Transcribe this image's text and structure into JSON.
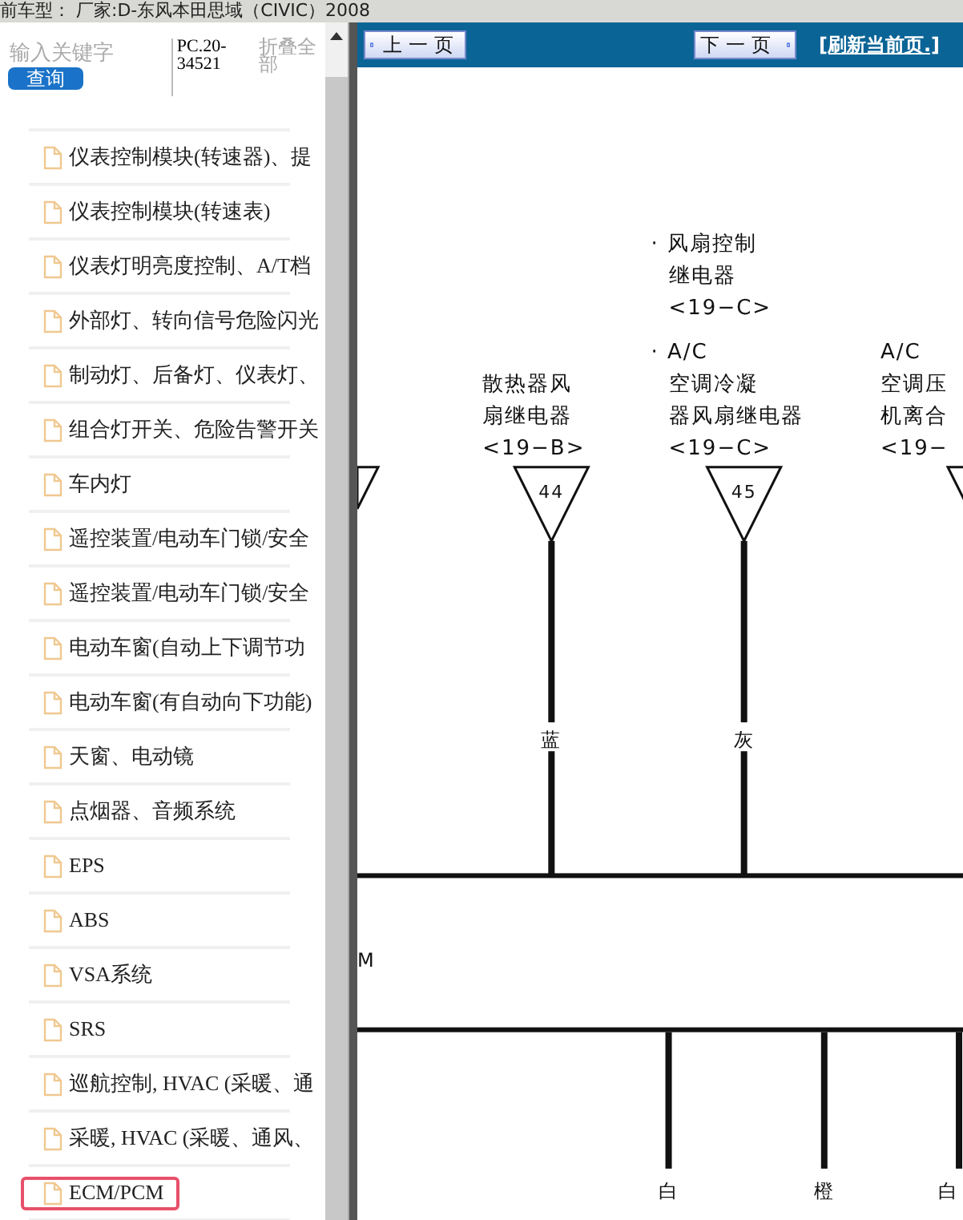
{
  "top_bar": {
    "vehicle": "前车型：  厂家:D-东风本田思域（CIVIC）2008"
  },
  "sidebar": {
    "search": {
      "placeholder": "输入关键字",
      "button": "查询"
    },
    "code": "PC.20-34521",
    "collapse_all": "折叠全部",
    "items": [
      {
        "label": "仪表控制模块(转速器)、提",
        "selected": false
      },
      {
        "label": "仪表控制模块(转速表)",
        "selected": false
      },
      {
        "label": "仪表灯明亮度控制、A/T档",
        "selected": false
      },
      {
        "label": "外部灯、转向信号危险闪光",
        "selected": false
      },
      {
        "label": "制动灯、后备灯、仪表灯、",
        "selected": false
      },
      {
        "label": "组合灯开关、危险告警开关",
        "selected": false
      },
      {
        "label": "车内灯",
        "selected": false
      },
      {
        "label": "遥控装置/电动车门锁/安全",
        "selected": false
      },
      {
        "label": "遥控装置/电动车门锁/安全",
        "selected": false
      },
      {
        "label": "电动车窗(自动上下调节功",
        "selected": false
      },
      {
        "label": "电动车窗(有自动向下功能)",
        "selected": false
      },
      {
        "label": "天窗、电动镜",
        "selected": false
      },
      {
        "label": "点烟器、音频系统",
        "selected": false
      },
      {
        "label": "EPS",
        "selected": false
      },
      {
        "label": "ABS",
        "selected": false
      },
      {
        "label": "VSA系统",
        "selected": false
      },
      {
        "label": "SRS",
        "selected": false
      },
      {
        "label": "巡航控制, HVAC (采暖、通",
        "selected": false
      },
      {
        "label": "采暖, HVAC (采暖、通风、",
        "selected": false
      },
      {
        "label": "ECM/PCM",
        "selected": true
      }
    ]
  },
  "viewer": {
    "prev_button": "上一页",
    "next_button": "下一页",
    "refresh_link": "[刷新当前页.]",
    "diagram": {
      "note": [
        "· 风扇控制",
        "继电器",
        "<19−C>"
      ],
      "connectors": [
        {
          "pin": "44",
          "label": [
            "散热器风",
            "扇继电器",
            "<19−B>"
          ],
          "wire": "蓝"
        },
        {
          "pin": "45",
          "label": [
            "· A/C",
            "空调冷凝",
            "器风扇继电器",
            "<19−C>"
          ],
          "wire": "灰"
        },
        {
          "label": [
            "A/C",
            "空调压",
            "机离合",
            "<19−"
          ]
        }
      ],
      "side_label": "M",
      "lower_wires": [
        {
          "label": "白"
        },
        {
          "label": "橙"
        },
        {
          "label": "白"
        }
      ]
    }
  }
}
